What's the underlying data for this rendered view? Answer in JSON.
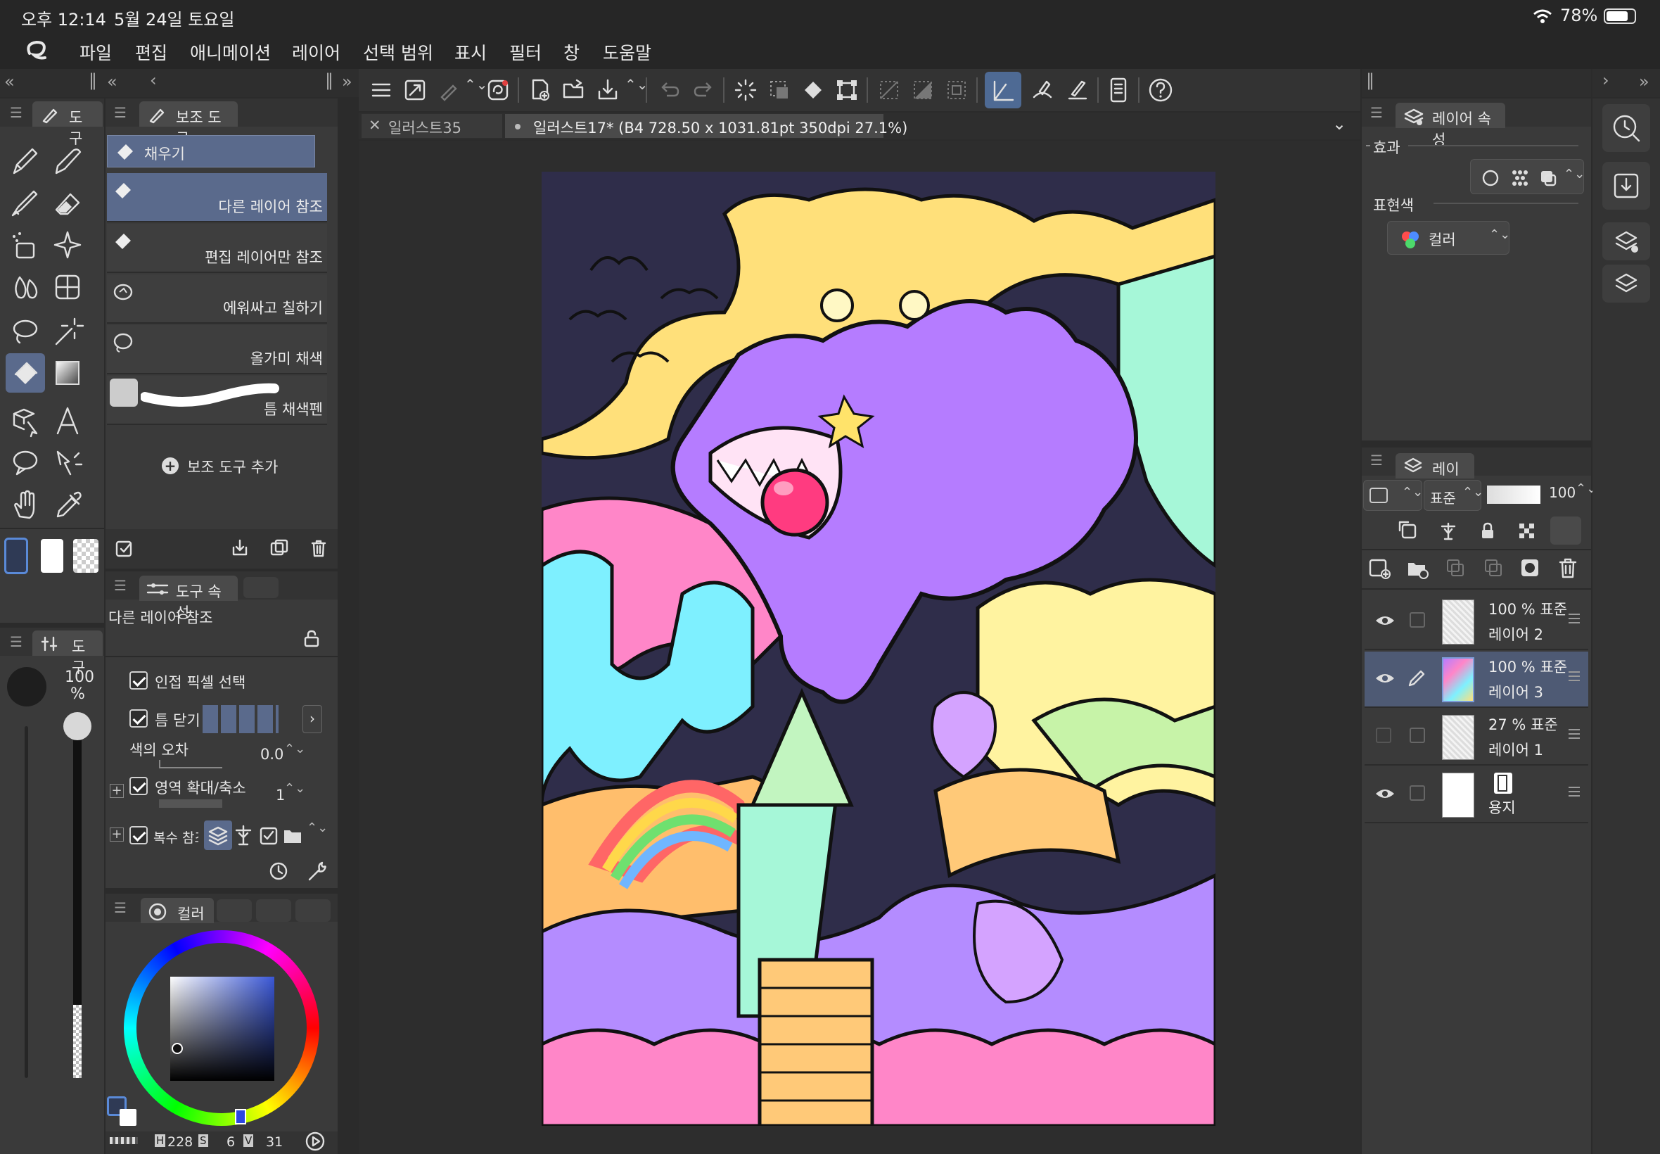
{
  "status_bar": {
    "time": "오후 12:14",
    "date": "5월 24일 토요일",
    "battery": "78%"
  },
  "menu": [
    "파일",
    "편집",
    "애니메이션",
    "레이어",
    "선택 범위",
    "표시",
    "필터",
    "창",
    "도움말"
  ],
  "doc_tabs": [
    {
      "label": "일러스트35",
      "active": false
    },
    {
      "label": "일러스트17* (B4 728.50 x 1031.81pt 350dpi 27.1%)",
      "active": true
    }
  ],
  "tool_panel": {
    "tab_label": "도구"
  },
  "sub_tool_panel": {
    "tab_label": "보조 도구",
    "group_label": "채우기",
    "items": [
      {
        "label": "다른 레이어 참조",
        "selected": true
      },
      {
        "label": "편집 레이어만 참조",
        "selected": false
      },
      {
        "label": "에워싸고 칠하기",
        "selected": false
      },
      {
        "label": "올가미 채색",
        "selected": false
      },
      {
        "label": "틈 채색펜",
        "selected": false
      }
    ],
    "add_label": "보조 도구 추가"
  },
  "tool_property": {
    "tab_label": "도구 속성",
    "preset_name": "다른 레이어 참조",
    "options": {
      "adjacent_pixel": "인접 픽셀 선택",
      "close_gap": "틈 닫기",
      "color_tolerance": {
        "label": "색의 오차",
        "value": "0.0"
      },
      "area_scaling": {
        "label": "영역 확대/축소",
        "value": "1"
      },
      "multi_ref": "복수 참조"
    }
  },
  "brush_size_panel": {
    "tab_label": "도구",
    "opacity": "100",
    "opacity_unit": "%"
  },
  "color_panel": {
    "tab_label": "컬러",
    "h_label": "H",
    "h": "228",
    "s_label": "S",
    "s": "6",
    "v_label": "V",
    "v": "31",
    "main_color": "#3a57d6"
  },
  "layer_property": {
    "tab_label": "레이어 속성",
    "effect_label": "효과",
    "expression_color_label": "표현색",
    "expression_color_value": "컬러"
  },
  "layer_panel": {
    "tab_label": "레이어",
    "blend_mode": "표준",
    "opacity": "100",
    "layers": [
      {
        "opacity": "100 %",
        "mode": "표준",
        "name": "레이어 2",
        "visible": true,
        "active": false
      },
      {
        "opacity": "100 %",
        "mode": "표준",
        "name": "레이어 3",
        "visible": true,
        "active": true
      },
      {
        "opacity": "27 %",
        "mode": "표준",
        "name": "레이어 1",
        "visible": false,
        "active": false
      },
      {
        "opacity": "",
        "mode": "",
        "name": "용지",
        "visible": true,
        "active": false
      }
    ]
  },
  "colors": {
    "accent": "#5a6a8c",
    "canvas_bg": "#2f2d4a"
  }
}
